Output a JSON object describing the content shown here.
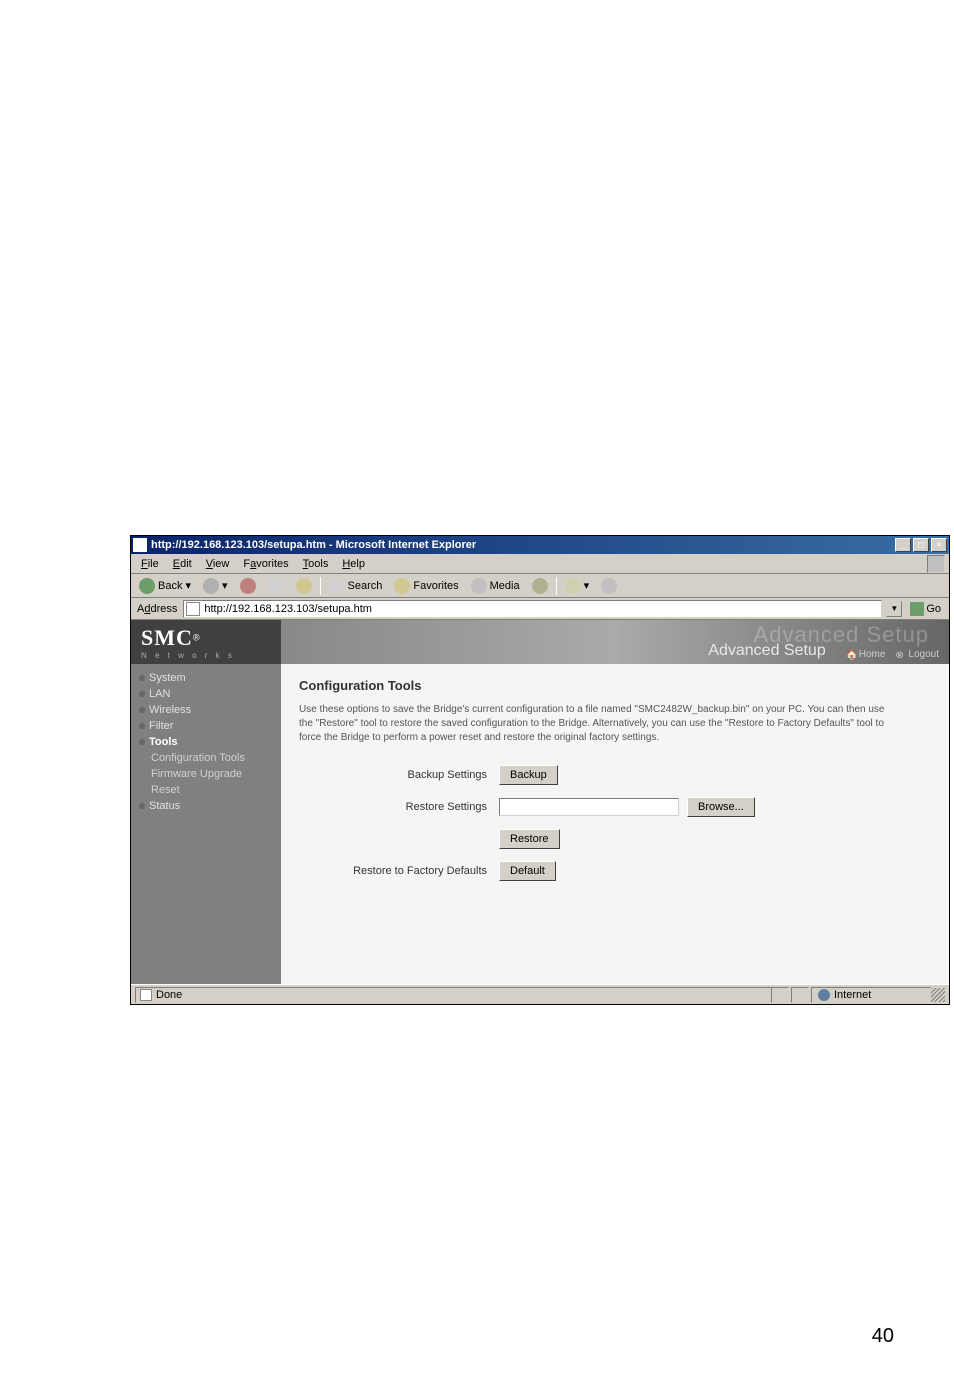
{
  "page_number": "40",
  "window": {
    "title": "http://192.168.123.103/setupa.htm - Microsoft Internet Explorer"
  },
  "menu": {
    "file": "File",
    "edit": "Edit",
    "view": "View",
    "favorites": "Favorites",
    "tools": "Tools",
    "help": "Help"
  },
  "toolbar": {
    "back": "Back",
    "search": "Search",
    "favorites": "Favorites",
    "media": "Media"
  },
  "addressbar": {
    "label": "Address",
    "url": "http://192.168.123.103/setupa.htm",
    "go": "Go"
  },
  "brand": {
    "logo": "SMC",
    "reg": "®",
    "sub": "N e t w o r k s"
  },
  "banner": {
    "ghost": "Advanced Setup",
    "title": "Advanced Setup",
    "home": "Home",
    "logout": "Logout"
  },
  "sidebar": {
    "system": "System",
    "lan": "LAN",
    "wireless": "Wireless",
    "filter": "Filter",
    "tools": "Tools",
    "config_tools": "Configuration Tools",
    "firmware": "Firmware Upgrade",
    "reset": "Reset",
    "status": "Status"
  },
  "main": {
    "heading": "Configuration Tools",
    "para": "Use these options to save the Bridge's current configuration to a file named \"SMC2482W_backup.bin\" on your PC. You can then use the \"Restore\" tool to restore the saved configuration to the Bridge. Alternatively, you can use the \"Restore to Factory Defaults\" tool to force the Bridge to perform a power reset and restore the original factory settings.",
    "backup_label": "Backup Settings",
    "backup_btn": "Backup",
    "restore_label": "Restore Settings",
    "browse_btn": "Browse...",
    "restore_btn": "Restore",
    "defaults_label": "Restore to Factory Defaults",
    "default_btn": "Default"
  },
  "status": {
    "done": "Done",
    "zone": "Internet"
  }
}
